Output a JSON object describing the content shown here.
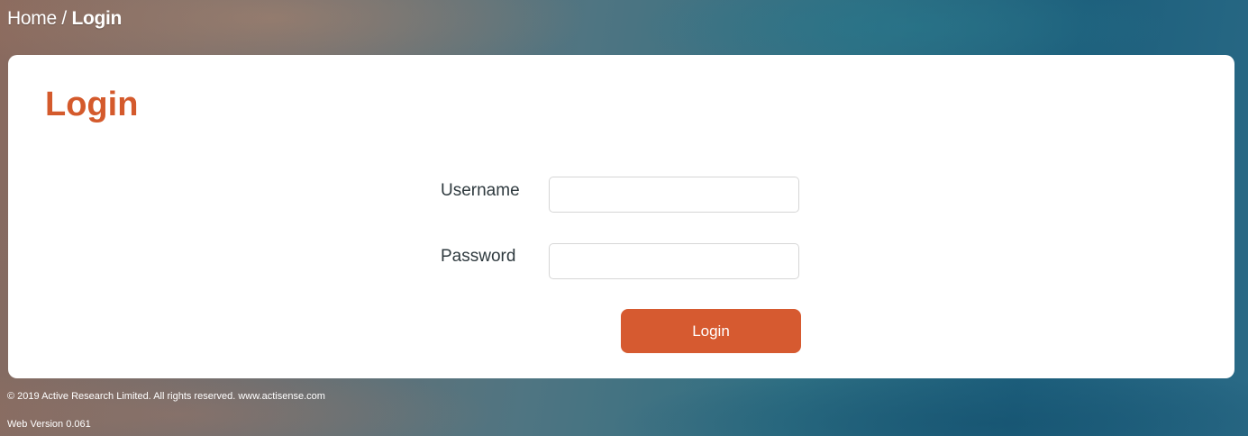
{
  "breadcrumb": {
    "home": "Home",
    "separator": " / ",
    "current": "Login"
  },
  "login_form": {
    "title": "Login",
    "username_label": "Username",
    "username_value": "",
    "password_label": "Password",
    "password_value": "",
    "submit_label": "Login"
  },
  "footer": {
    "copyright": "© 2019 Active Research Limited. All rights reserved.  www.actisense.com",
    "version": "Web Version 0.061"
  },
  "colors": {
    "accent": "#d45a2c",
    "button": "#d65a30"
  }
}
